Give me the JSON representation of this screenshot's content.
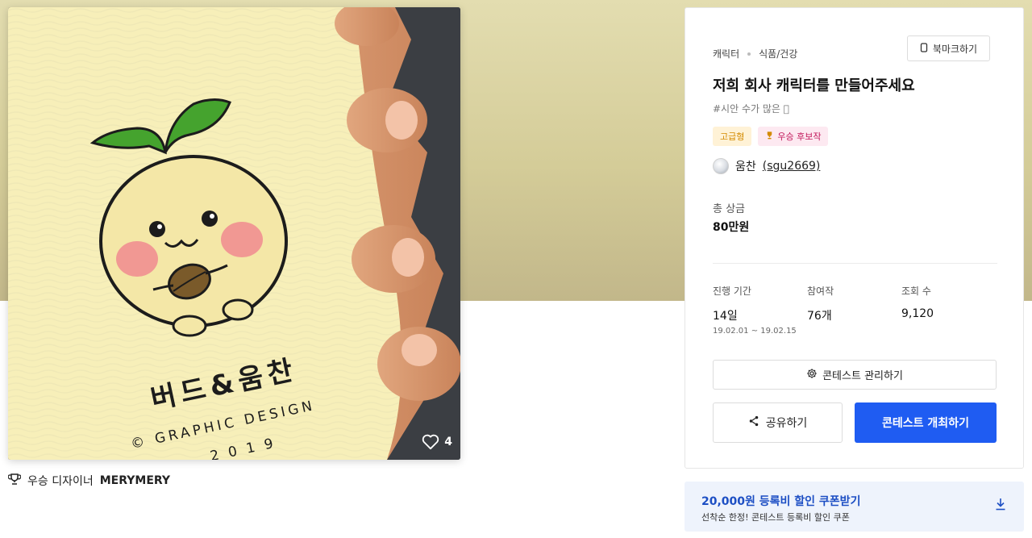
{
  "artwork": {
    "likes": "4",
    "product_text": "버드&움찬",
    "graphic_design": "© GRAPHIC DESIGN",
    "year": "2019"
  },
  "winner": {
    "prefix": "우승 디자이너",
    "name": "MERYMERY"
  },
  "contest": {
    "breadcrumb": [
      "캐릭터",
      "식품/건강"
    ],
    "bookmark_label": "북마크하기",
    "title": "저희 회사 캐릭터를 만들어주세요",
    "subtitle": "#시안 수가 많은 🏻",
    "badge_grade": "고급형",
    "badge_award": "우승 후보작",
    "author_name": "움찬",
    "author_id": "(sgu2669)",
    "prize_label": "총 상금",
    "prize_value": "80만원",
    "stats": {
      "period_label": "진행 기간",
      "period_value": "14일",
      "period_range": "19.02.01 ~ 19.02.15",
      "entries_label": "참여작",
      "entries_value": "76개",
      "views_label": "조회 수",
      "views_value": "9,120"
    },
    "manage_label": "콘테스트 관리하기",
    "share_label": "공유하기",
    "host_label": "콘테스트 개최하기"
  },
  "coupon": {
    "title": "20,000원 등록비 할인 쿠폰받기",
    "subtitle": "선착순 한정! 콘테스트 등록비 할인 쿠폰"
  },
  "colors": {
    "primary": "#1f5cf2",
    "coupon_bg": "#eef3fc",
    "coupon_text": "#1d4fc4",
    "badge_grade_text": "#d38a00",
    "badge_award_text": "#c2185b"
  }
}
